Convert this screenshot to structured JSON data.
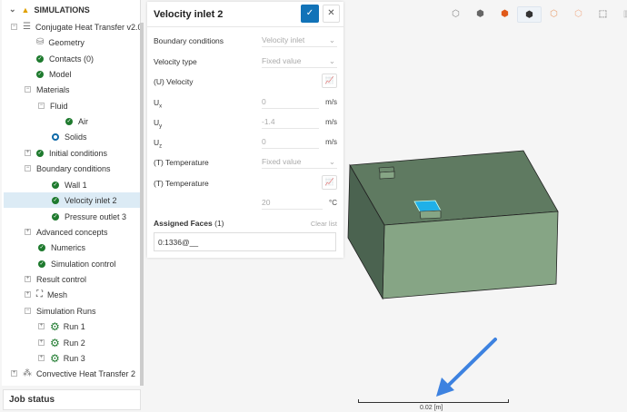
{
  "sidebar": {
    "header": "SIMULATIONS",
    "items": [
      {
        "label": "Conjugate Heat Transfer v2.0"
      },
      {
        "label": "Geometry"
      },
      {
        "label": "Contacts (0)"
      },
      {
        "label": "Model"
      },
      {
        "label": "Materials"
      },
      {
        "label": "Fluid"
      },
      {
        "label": "Air"
      },
      {
        "label": "Solids"
      },
      {
        "label": "Initial conditions"
      },
      {
        "label": "Boundary conditions"
      },
      {
        "label": "Wall 1"
      },
      {
        "label": "Velocity inlet 2"
      },
      {
        "label": "Pressure outlet 3"
      },
      {
        "label": "Advanced concepts"
      },
      {
        "label": "Numerics"
      },
      {
        "label": "Simulation control"
      },
      {
        "label": "Result control"
      },
      {
        "label": "Mesh"
      },
      {
        "label": "Simulation Runs"
      },
      {
        "label": "Run 1"
      },
      {
        "label": "Run 2"
      },
      {
        "label": "Run 3"
      },
      {
        "label": "Convective Heat Transfer 2"
      }
    ],
    "job_status": "Job status"
  },
  "panel": {
    "title": "Velocity inlet 2",
    "boundary_conditions_label": "Boundary conditions",
    "boundary_conditions_value": "Velocity inlet",
    "velocity_type_label": "Velocity type",
    "velocity_type_value": "Fixed value",
    "velocity_label": "(U) Velocity",
    "ux_label": "Ux",
    "ux_value": "0",
    "ux_unit": "m/s",
    "uy_label": "Uy",
    "uy_value": "-1.4",
    "uy_unit": "m/s",
    "uz_label": "Uz",
    "uz_value": "0",
    "uz_unit": "m/s",
    "temp_type_label": "(T) Temperature",
    "temp_type_value": "Fixed value",
    "temp_label": "(T) Temperature",
    "temp_value": "20",
    "temp_unit": "°C",
    "assigned_faces_label": "Assigned Faces",
    "assigned_faces_count": "(1)",
    "clear_list": "Clear list",
    "face_value": "0:1336@__"
  },
  "viewport": {
    "scale_label": "0.02 [m]",
    "colors": {
      "box_top": "#5f7a61",
      "box_front": "#86a585",
      "box_side": "#4b6350",
      "selected_face": "#1fb0e8",
      "arrow": "#3d82e0"
    }
  }
}
